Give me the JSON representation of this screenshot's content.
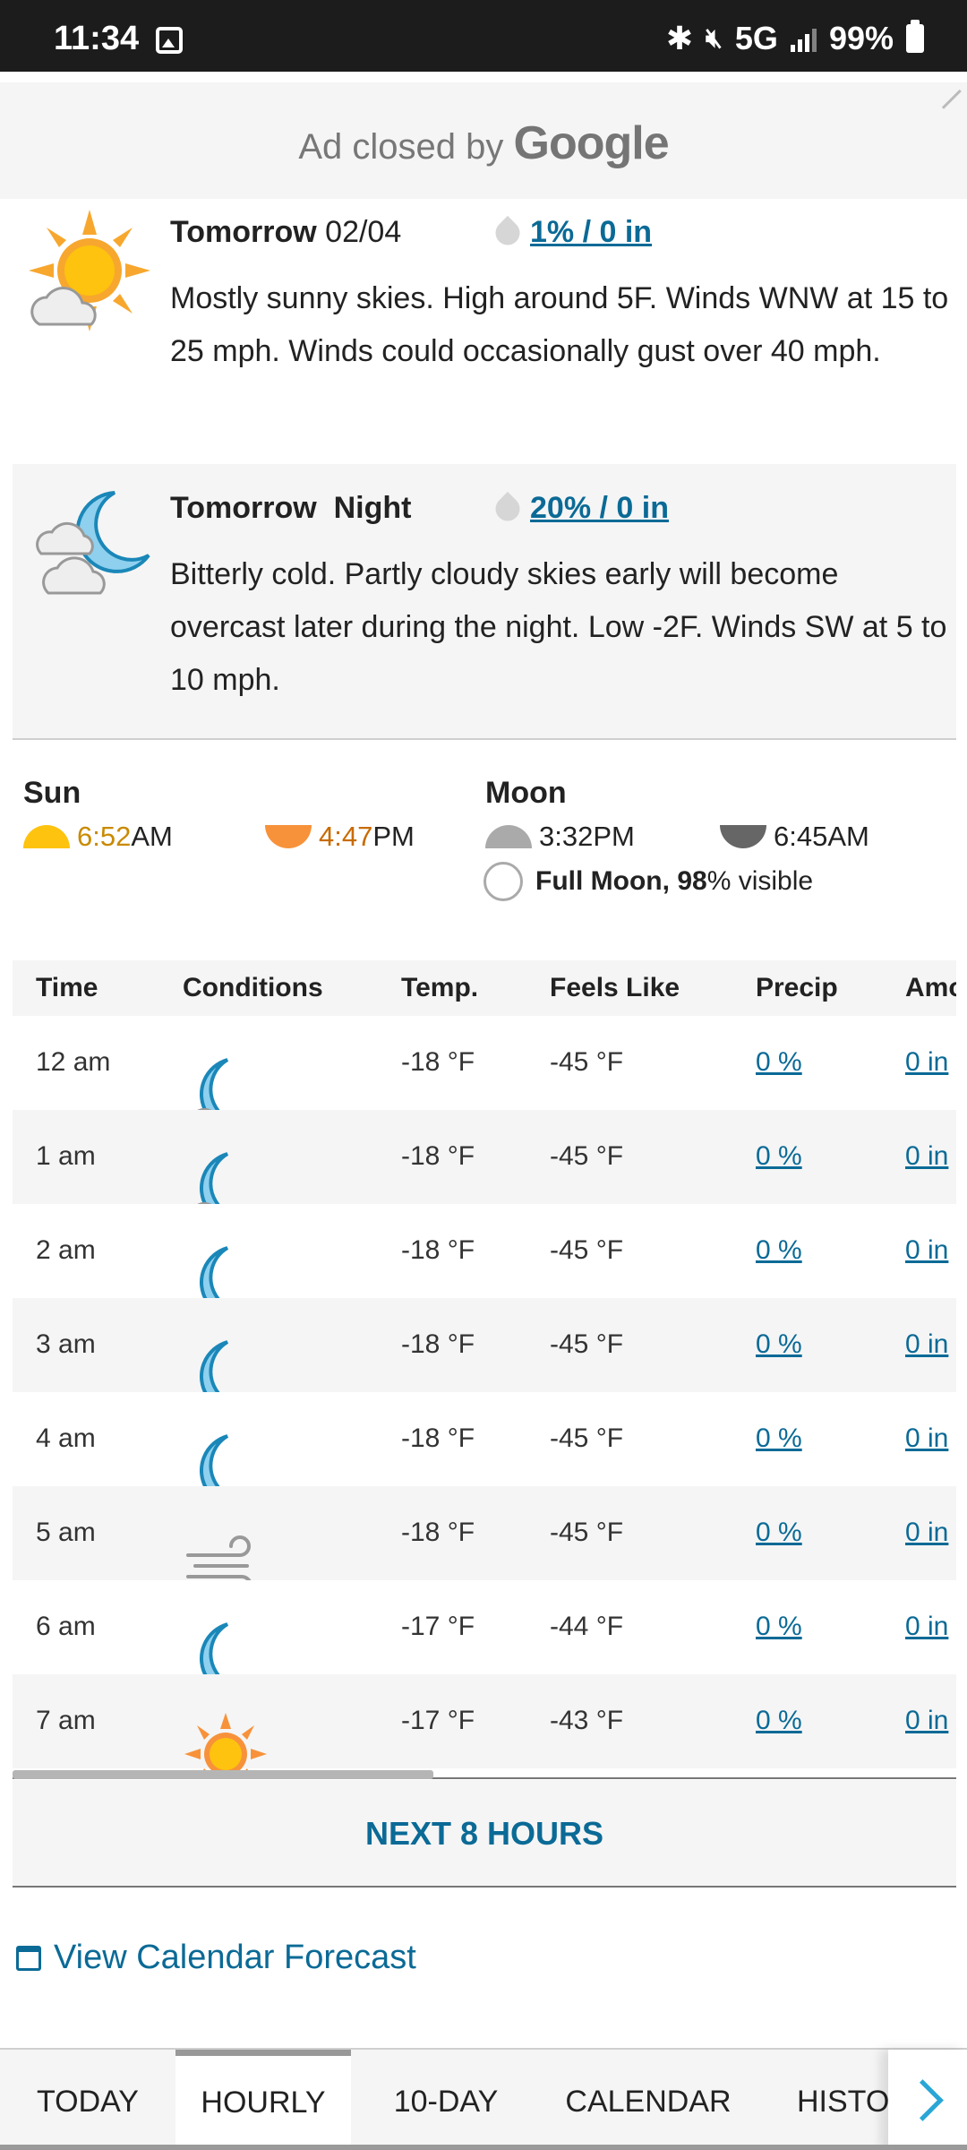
{
  "status_bar": {
    "time": "11:34",
    "network": "5G",
    "battery": "99%"
  },
  "ad": {
    "prefix": "Ad closed by",
    "brand": "Google"
  },
  "forecast_day": {
    "title_bold": "Tomorrow",
    "date": "02/04",
    "precip": "1% / 0 in",
    "description": "Mostly sunny skies. High around 5F. Winds WNW at 15 to 25 mph. Winds could occasionally gust over 40 mph.",
    "icon": "sun-cloud-icon"
  },
  "forecast_night": {
    "title": "Tomorrow  Night",
    "precip": "20% / 0 in",
    "description": "Bitterly cold. Partly cloudy skies early will become overcast later during the night. Low -2F. Winds SW at 5 to 10 mph.",
    "icon": "moon-clouds-icon"
  },
  "astro": {
    "sun_heading": "Sun",
    "sunrise_time": "6:52",
    "sunrise_ampm": "AM",
    "sunset_time": "4:47",
    "sunset_ampm": "PM",
    "moon_heading": "Moon",
    "moonrise": "3:32PM",
    "moonset": "6:45AM",
    "phase_name": "Full Moon,",
    "phase_pct": "98",
    "phase_suffix": "% visible"
  },
  "table": {
    "headers": [
      "Time",
      "Conditions",
      "Temp.",
      "Feels Like",
      "Precip",
      "Amount"
    ],
    "rows": [
      {
        "time": "12 am",
        "icon": "moon-cloud-icon",
        "temp": "-18 °F",
        "feels": "-45 °F",
        "precip": "0 %",
        "amount": "0 in"
      },
      {
        "time": "1 am",
        "icon": "moon-cloud-icon",
        "temp": "-18 °F",
        "feels": "-45 °F",
        "precip": "0 %",
        "amount": "0 in"
      },
      {
        "time": "2 am",
        "icon": "moon-icon",
        "temp": "-18 °F",
        "feels": "-45 °F",
        "precip": "0 %",
        "amount": "0 in"
      },
      {
        "time": "3 am",
        "icon": "moon-icon",
        "temp": "-18 °F",
        "feels": "-45 °F",
        "precip": "0 %",
        "amount": "0 in"
      },
      {
        "time": "4 am",
        "icon": "moon-icon",
        "temp": "-18 °F",
        "feels": "-45 °F",
        "precip": "0 %",
        "amount": "0 in"
      },
      {
        "time": "5 am",
        "icon": "wind-icon",
        "temp": "-18 °F",
        "feels": "-45 °F",
        "precip": "0 %",
        "amount": "0 in"
      },
      {
        "time": "6 am",
        "icon": "moon-icon",
        "temp": "-17 °F",
        "feels": "-44 °F",
        "precip": "0 %",
        "amount": "0 in"
      },
      {
        "time": "7 am",
        "icon": "sun-icon",
        "temp": "-17 °F",
        "feels": "-43 °F",
        "precip": "0 %",
        "amount": "0 in"
      }
    ]
  },
  "next_button": "NEXT 8 HOURS",
  "calendar_link": "View Calendar Forecast",
  "tabs": [
    "TODAY",
    "HOURLY",
    "10-DAY",
    "CALENDAR",
    "HISTORY"
  ],
  "active_tab": "HOURLY",
  "colors": {
    "accent": "#0b6a96",
    "sun": "#f7a72e",
    "moon": "#8fd0ef",
    "panel": "#f5f5f5"
  }
}
